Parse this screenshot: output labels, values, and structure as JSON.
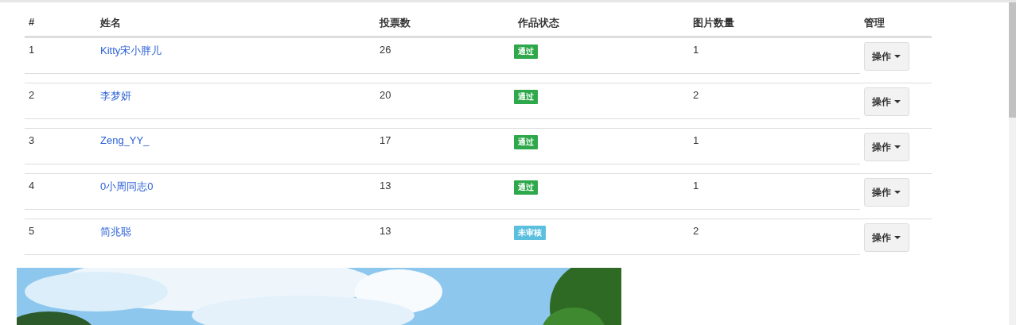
{
  "table": {
    "columns": [
      "#",
      "姓名",
      "投票数",
      "作品状态",
      "图片数量",
      "管理"
    ],
    "rows": [
      {
        "index": "1",
        "name": "Kitty宋小胖儿",
        "votes": "26",
        "status": {
          "label": "通过",
          "color": "#2ea84a"
        },
        "images": "1",
        "action": "操作"
      },
      {
        "index": "2",
        "name": "李梦妍",
        "votes": "20",
        "status": {
          "label": "通过",
          "color": "#2ea84a"
        },
        "images": "2",
        "action": "操作"
      },
      {
        "index": "3",
        "name": "Zeng_YY_",
        "votes": "17",
        "status": {
          "label": "通过",
          "color": "#2ea84a"
        },
        "images": "1",
        "action": "操作"
      },
      {
        "index": "4",
        "name": "0小周同志0",
        "votes": "13",
        "status": {
          "label": "通过",
          "color": "#2ea84a"
        },
        "images": "1",
        "action": "操作"
      },
      {
        "index": "5",
        "name": "简兆聪",
        "votes": "13",
        "status": {
          "label": "未审核",
          "color": "#5bc0de"
        },
        "images": "2",
        "action": "操作"
      }
    ]
  }
}
